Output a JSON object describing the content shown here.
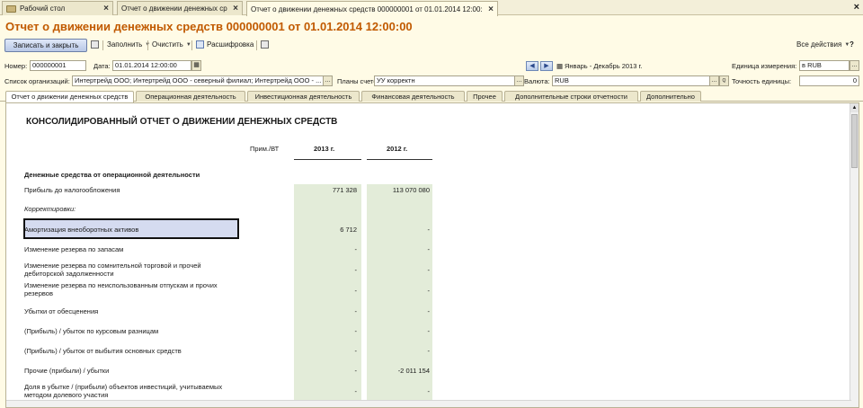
{
  "window_tabs": [
    {
      "label": "Рабочий стол",
      "active": false
    },
    {
      "label": "Отчет о движении денежных средств",
      "active": false
    },
    {
      "label": "Отчет о движении денежных средств 000000001 от 01.01.2014 12:00:00",
      "active": true
    }
  ],
  "form_title": "Отчет о движении денежных средств 000000001 от 01.01.2014 12:00:00",
  "toolbar": {
    "save_close": "Записать и закрыть",
    "fill": "Заполнить",
    "clear": "Очистить",
    "breakdown": "Расшифровка",
    "all_actions": "Все действия",
    "help": "?"
  },
  "fields": {
    "number_label": "Номер:",
    "number_value": "000000001",
    "date_label": "Дата:",
    "date_value": "01.01.2014 12:00:00",
    "period_text": "Январь - Декабрь 2013 г.",
    "unit_label": "Единица измерения:",
    "unit_value": "в RUB",
    "orgs_label": "Список организаций:",
    "orgs_value": "Интертрейд ООО; Интертрейд ООО - северный филиал; Интертрейд ООО - ...",
    "chart_label": "Планы счетов:",
    "chart_value": "УУ корректн",
    "currency_label": "Валюта:",
    "currency_value": "RUB",
    "precision_label": "Точность единицы:",
    "precision_value": "0"
  },
  "content_tabs": [
    "Отчет о движении денежных средств",
    "Операционная деятельность",
    "Инвестиционная деятельность",
    "Финансовая деятельность",
    "Прочее",
    "Дополнительные строки отчетности",
    "Дополнительно"
  ],
  "report": {
    "title": "КОНСОЛИДИРОВАННЫЙ ОТЧЕТ О ДВИЖЕНИИ ДЕНЕЖНЫХ СРЕДСТВ",
    "col_note": "Прим./ВТ",
    "col_2013": "2013 г.",
    "col_2012": "2012 г.",
    "section": "Денежные средства от операционной деятельности",
    "rows": [
      {
        "label": "Прибыль до налогообложения",
        "v2013": "771 328",
        "v2012": "113 070 080"
      },
      {
        "label": "Корректировки:",
        "v2013": "",
        "v2012": ""
      },
      {
        "label": "Амортизация внеоборотных активов",
        "v2013": "6 712",
        "v2012": "-"
      },
      {
        "label": "Изменение резерва по запасам",
        "v2013": "-",
        "v2012": "-"
      },
      {
        "label": "Изменение резерва по сомнительной торговой и прочей дебиторской задолженности",
        "v2013": "-",
        "v2012": "-"
      },
      {
        "label": "Изменение резерва по неиспользованным отпускам и прочих резервов",
        "v2013": "-",
        "v2012": "-"
      },
      {
        "label": "Убытки от обесценения",
        "v2013": "-",
        "v2012": "-"
      },
      {
        "label": "(Прибыль) / убыток по курсовым разницам",
        "v2013": "-",
        "v2012": "-"
      },
      {
        "label": "(Прибыль) / убыток  от выбытия основных средств",
        "v2013": "-",
        "v2012": "-"
      },
      {
        "label": "Прочие (прибыли) / убытки",
        "v2013": "-",
        "v2012": "-2 011 154"
      },
      {
        "label": "Доля в убытке / (прибыли) объектов инвестиций, учитываемых методом долевого участия",
        "v2013": "-",
        "v2012": "-"
      }
    ]
  }
}
